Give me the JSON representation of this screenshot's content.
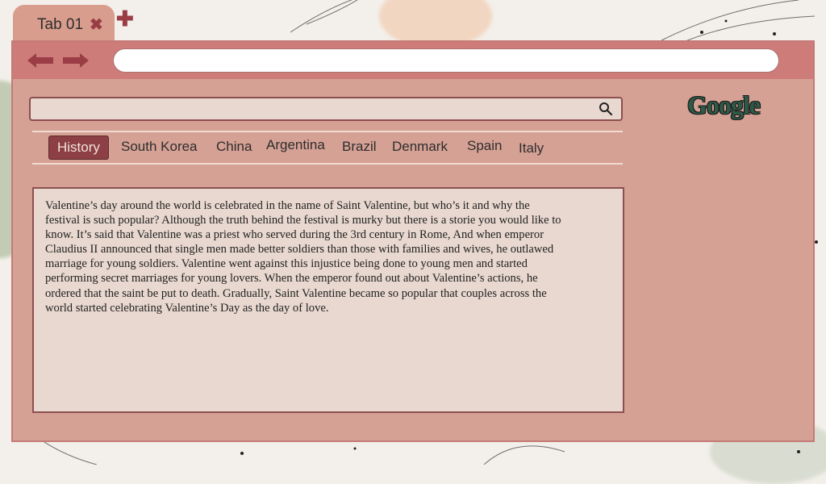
{
  "tab": {
    "title": "Tab 01",
    "close_icon": "close-icon",
    "add_icon": "add-tab-icon"
  },
  "toolbar": {
    "back_icon": "arrow-left-icon",
    "forward_icon": "arrow-right-icon",
    "address_value": ""
  },
  "search": {
    "value": "",
    "icon": "search-icon"
  },
  "logo": {
    "text": "Google"
  },
  "nav": {
    "items": [
      {
        "label": "History"
      },
      {
        "label": "South Korea"
      },
      {
        "label": "China"
      },
      {
        "label": "Argentina"
      },
      {
        "label": "Brazil"
      },
      {
        "label": "Denmark"
      },
      {
        "label": "Spain"
      },
      {
        "label": "Italy"
      }
    ],
    "active_index": 0
  },
  "article": {
    "text": "Valentine’s day around the world is celebrated in the name of Saint Valentine, but who’s it and why the festival is such popular? Although the truth behind the festival is murky but there is a storie you would like to know. It’s said that Valentine was a priest who served during the 3rd century in Rome, And when emperor Claudius II announced that single men made better soldiers than those with families and wives, he outlawed marriage for young soldiers. Valentine went against this injustice being done to young men and started performing secret marriages for young lovers. When the emperor found out about Valentine’s actions, he ordered that the saint be put to death. Gradually, Saint Valentine became so popular that couples across the world started celebrating Valentine’s Day as the day of love."
  },
  "colors": {
    "window": "#d99d8e",
    "toolbar": "#cd7c7a",
    "active_tab": "#8c3f44",
    "panel": "#e8d8cf",
    "accent_dark": "#8d4f4f"
  }
}
